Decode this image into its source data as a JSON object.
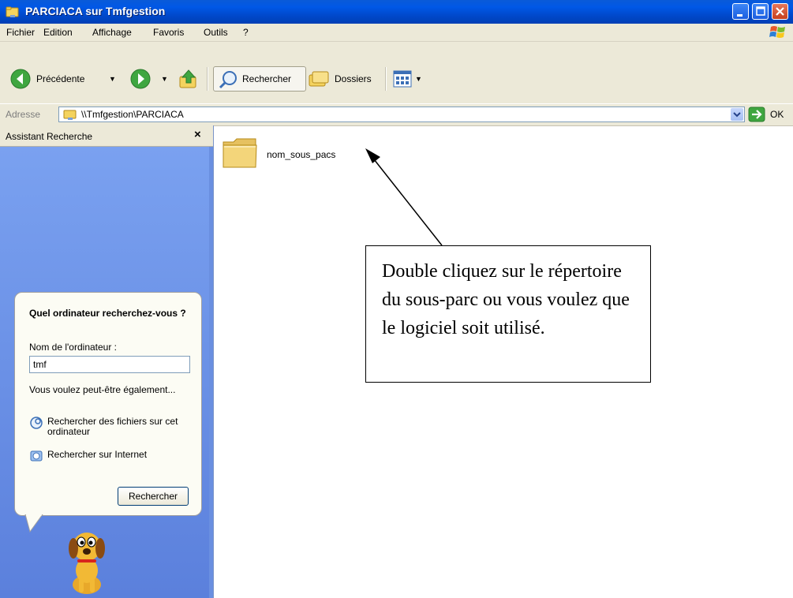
{
  "window": {
    "title": "PARCIACA sur Tmfgestion"
  },
  "menu": {
    "items": [
      "Fichier",
      "Edition",
      "Affichage",
      "Favoris",
      "Outils",
      "?"
    ]
  },
  "toolbar": {
    "back_label": "Précédente",
    "search_label": "Rechercher",
    "folders_label": "Dossiers"
  },
  "address": {
    "label": "Adresse",
    "value": "\\\\Tmfgestion\\PARCIACA",
    "go_label": "OK"
  },
  "search_pane": {
    "title": "Assistant Recherche",
    "close_symbol": "×",
    "question": "Quel ordinateur recherchez-vous ?",
    "field_label": "Nom de l'ordinateur :",
    "field_value": "tmf",
    "maybe_text": "Vous voulez peut-être également...",
    "links": [
      "Rechercher des fichiers sur cet ordinateur",
      "Rechercher sur Internet"
    ],
    "submit_label": "Rechercher"
  },
  "content": {
    "folders": [
      "nom_sous_pacs"
    ]
  },
  "annotation": {
    "text": "Double cliquez sur le répertoire du sous-parc ou vous voulez que le logiciel soit utilisé."
  },
  "colors": {
    "title_bar": "#0058e6",
    "chrome": "#ece9d8",
    "side_panel": "#6a8fe0",
    "close_button": "#c7401e",
    "folder": "#f3d57a"
  },
  "icons": {
    "window": "folder-network-icon",
    "back": "back-arrow-icon",
    "forward": "forward-arrow-icon",
    "up": "up-folder-icon",
    "search": "magnifier-icon",
    "folders": "folders-icon",
    "views": "views-icon",
    "go": "go-arrow-icon"
  }
}
